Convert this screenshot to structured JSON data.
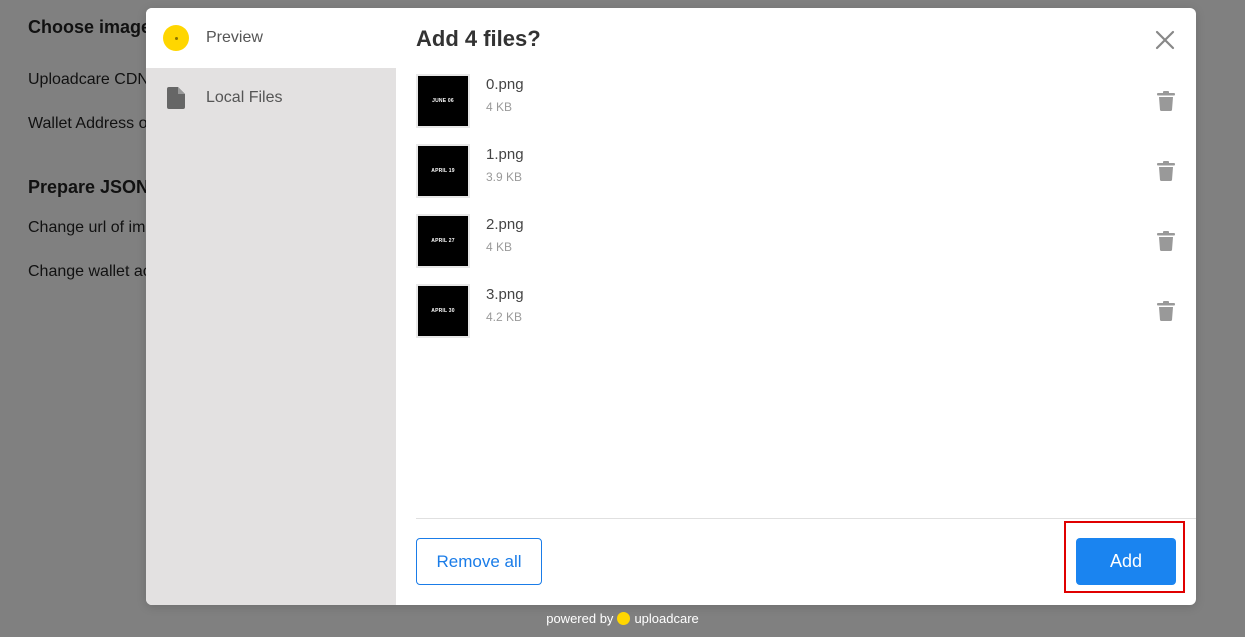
{
  "background_page": {
    "headings": [
      "Choose image",
      "Prepare JSON"
    ],
    "lines": [
      "Uploadcare CDN",
      "Wallet Address o",
      "Change url of im",
      "Change wallet ac"
    ]
  },
  "sidebar": {
    "items": [
      {
        "label": "Preview",
        "icon": "preview-dot-icon",
        "active": true
      },
      {
        "label": "Local Files",
        "icon": "file-icon",
        "active": false
      }
    ]
  },
  "dialog": {
    "title": "Add 4 files?",
    "close_icon": "close-icon"
  },
  "files": [
    {
      "name": "0.png",
      "size": "4 KB",
      "thumb_text": "JUNE 06"
    },
    {
      "name": "1.png",
      "size": "3.9 KB",
      "thumb_text": "APRIL 19"
    },
    {
      "name": "2.png",
      "size": "4 KB",
      "thumb_text": "APRIL 27"
    },
    {
      "name": "3.png",
      "size": "4.2 KB",
      "thumb_text": "APRIL 30"
    }
  ],
  "footer": {
    "remove_all_label": "Remove all",
    "add_label": "Add"
  },
  "powered_by": {
    "prefix": "powered by",
    "brand": "uploadcare"
  },
  "colors": {
    "accent": "#1a84f0",
    "brand_yellow": "#ffd600",
    "highlight": "#e00000",
    "overlay": "#808080"
  }
}
